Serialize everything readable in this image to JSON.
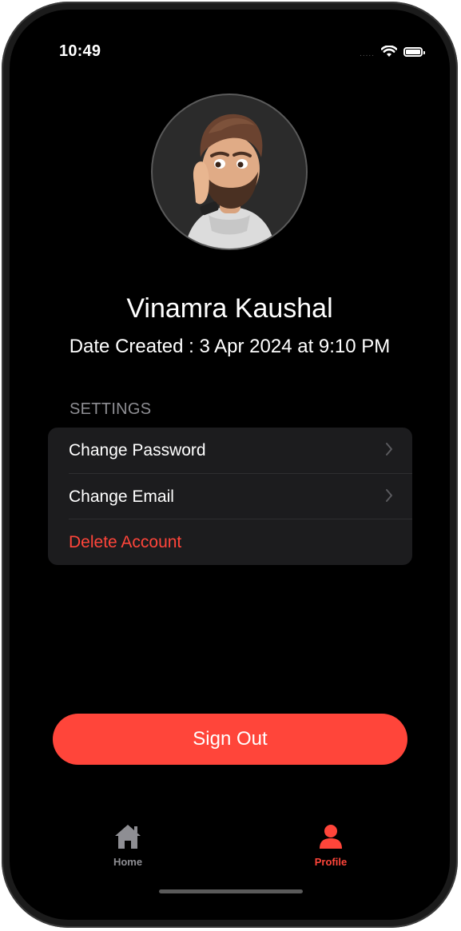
{
  "status_bar": {
    "time": "10:49",
    "signal_dots": "....."
  },
  "profile": {
    "name": "Vinamra Kaushal",
    "date_created": "Date Created : 3 Apr 2024 at 9:10 PM"
  },
  "settings": {
    "header": "SETTINGS",
    "items": [
      {
        "label": "Change Password",
        "style": "default"
      },
      {
        "label": "Change Email",
        "style": "default"
      },
      {
        "label": "Delete Account",
        "style": "destructive"
      }
    ]
  },
  "sign_out_label": "Sign Out",
  "tab_bar": {
    "items": [
      {
        "label": "Home",
        "icon": "house-icon",
        "selected": false
      },
      {
        "label": "Profile",
        "icon": "person-icon",
        "selected": true
      }
    ]
  },
  "colors": {
    "accent": "#FF453A",
    "background": "#000000",
    "card": "#1C1C1E",
    "secondary_text": "#8E8E93"
  }
}
